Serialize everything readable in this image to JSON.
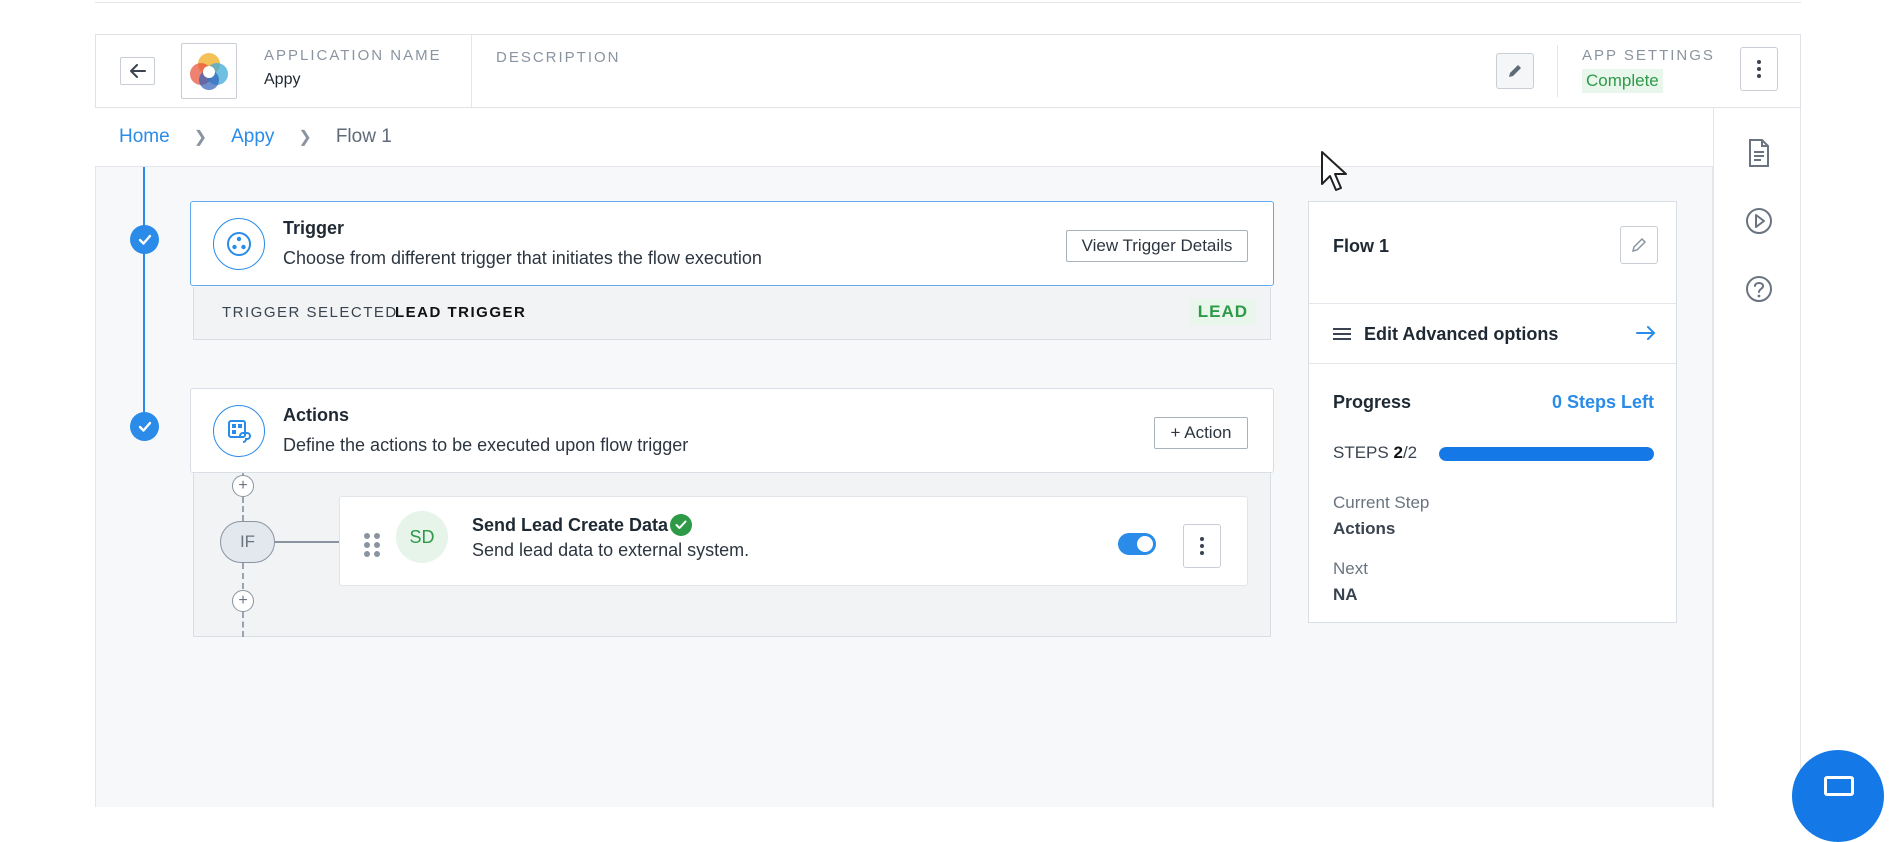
{
  "header": {
    "app_name_label": "APPLICATION NAME",
    "app_name_value": "Appy",
    "description_label": "DESCRIPTION",
    "app_settings_label": "APP SETTINGS",
    "app_settings_status": "Complete"
  },
  "breadcrumb": {
    "items": [
      "Home",
      "Appy",
      "Flow 1"
    ],
    "separator": ">"
  },
  "trigger": {
    "title": "Trigger",
    "subtitle": "Choose from different trigger that initiates the flow execution",
    "button": "View Trigger Details",
    "selected_label": "TRIGGER SELECTED",
    "selected_value": "LEAD TRIGGER",
    "badge": "LEAD"
  },
  "actions": {
    "title": "Actions",
    "subtitle": "Define the actions to be executed upon flow trigger",
    "button": "+ Action",
    "condition_node": "IF",
    "items": [
      {
        "avatar": "SD",
        "title": "Send Lead Create Data",
        "subtitle": "Send lead data to external system.",
        "enabled": true,
        "status": "check-circle-icon"
      }
    ]
  },
  "side_panel": {
    "flow_name": "Flow 1",
    "advanced_options": "Edit Advanced options",
    "progress_label": "Progress",
    "steps_left": "0 Steps Left",
    "steps_prefix": "STEPS",
    "steps_done": "2",
    "steps_total": "/2",
    "steps_fraction": 1.0,
    "current_step_label": "Current Step",
    "current_step_value": "Actions",
    "next_label": "Next",
    "next_value": "NA"
  },
  "right_rail": {
    "icons": [
      "document-icon",
      "play-circle-icon",
      "help-circle-icon"
    ]
  },
  "colors": {
    "primary": "#2a8be8",
    "success": "#2e9a48",
    "progress_fill": "#1478e6"
  }
}
